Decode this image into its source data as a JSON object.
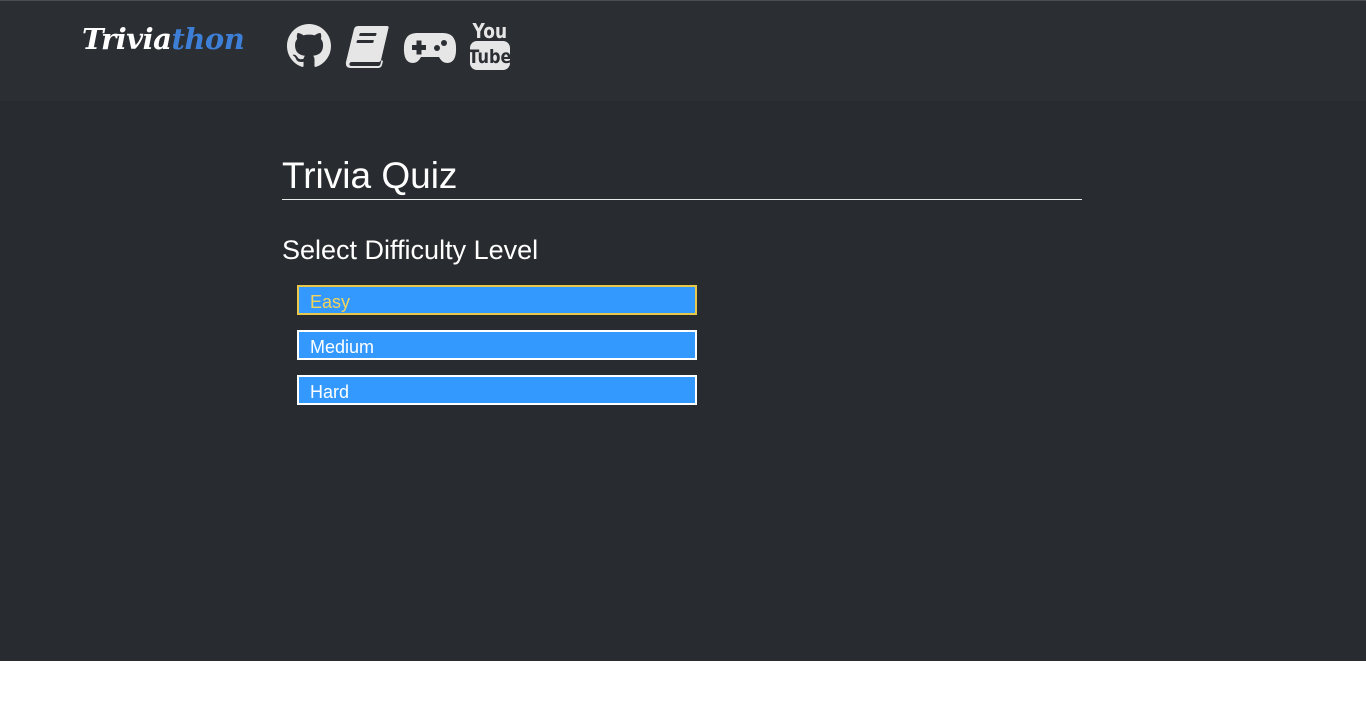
{
  "navbar": {
    "logo_part1": "Trivia",
    "logo_part2": "thon",
    "icons": [
      "github-icon",
      "book-icon",
      "gamepad-icon",
      "youtube-icon"
    ]
  },
  "main": {
    "title": "Trivia Quiz",
    "subtitle": "Select Difficulty Level",
    "options": [
      {
        "label": "Easy",
        "selected": true
      },
      {
        "label": "Medium",
        "selected": false
      },
      {
        "label": "Hard",
        "selected": false
      }
    ]
  },
  "colors": {
    "background": "#282b2f",
    "accent": "#3d7fd6",
    "option_bg": "#3399ff",
    "selected_border": "#e8c84a"
  }
}
